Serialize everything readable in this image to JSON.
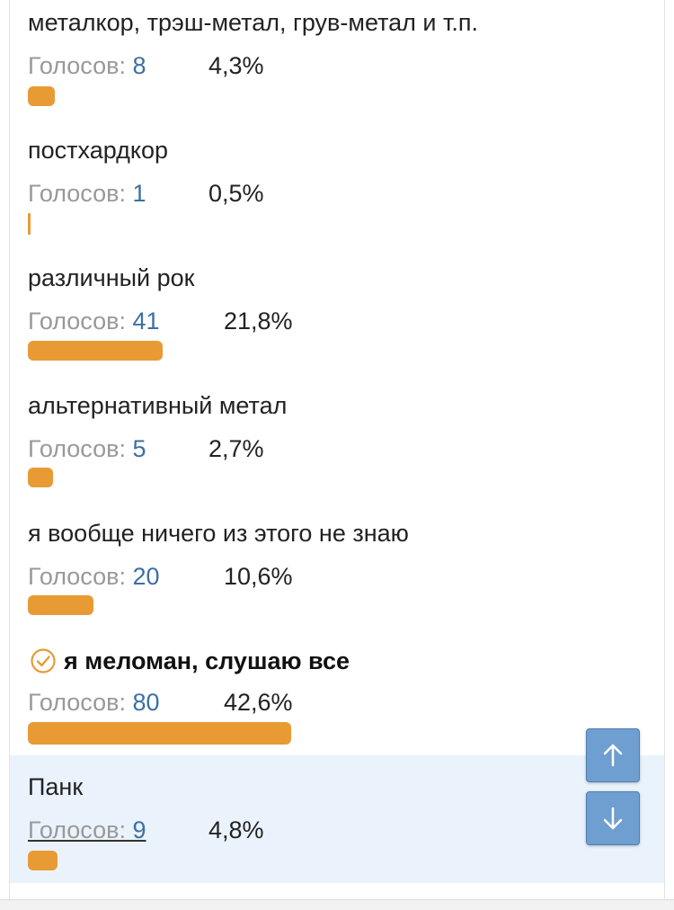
{
  "options": [
    {
      "label": "металкор, трэш-метал, грув-метал и т.п.",
      "votes_prefix": "Голосов: ",
      "votes": "8",
      "percent": "4,3%",
      "fraction": 0.043
    },
    {
      "label": "постхардкор",
      "votes_prefix": "Голосов: ",
      "votes": "1",
      "percent": "0,5%",
      "fraction": 0.005
    },
    {
      "label": "различный рок",
      "votes_prefix": "Голосов: ",
      "votes": "41",
      "percent": "21,8%",
      "fraction": 0.218
    },
    {
      "label": "альтернативный метал",
      "votes_prefix": "Голосов: ",
      "votes": "5",
      "percent": "2,7%",
      "fraction": 0.027
    },
    {
      "label": "я вообще ничего из этого не знаю",
      "votes_prefix": "Голосов: ",
      "votes": "20",
      "percent": "10,6%",
      "fraction": 0.106
    },
    {
      "label": "я меломан, слушаю все",
      "votes_prefix": "Голосов: ",
      "votes": "80",
      "percent": "42,6%",
      "fraction": 0.426,
      "selected": true
    },
    {
      "label": "Панк",
      "votes_prefix": "Голосов: ",
      "votes": "9",
      "percent": "4,8%",
      "fraction": 0.048
    }
  ],
  "colors": {
    "bar": "#e89b35",
    "link": "#3d6fa5",
    "highlight": "#eaf3fc",
    "nav_button": "#6f9fd1"
  },
  "icons": {
    "selected": "check-circle-icon",
    "scroll_up": "arrow-up-icon",
    "scroll_down": "arrow-down-icon"
  }
}
